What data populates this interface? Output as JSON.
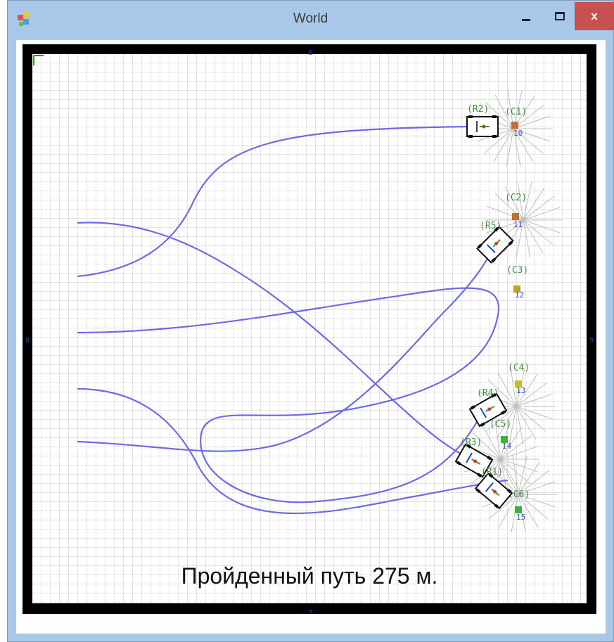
{
  "window": {
    "title": "World",
    "close_label": "x"
  },
  "arena": {
    "distance_text": "Пройденный путь 275 м.",
    "axis_top": "6",
    "axis_bottom": "7",
    "axis_left": "8",
    "axis_right": "9",
    "path_color": "#6b6bea",
    "wall_color": "#000000",
    "grid_color": "#c8c8c8",
    "label_color_green": "#3a9a3a",
    "label_color_blue": "#3050d0"
  },
  "robots": [
    {
      "label": "(R2)"
    },
    {
      "label": "(R5)"
    },
    {
      "label": "(R4)"
    },
    {
      "label": "(R3)"
    },
    {
      "label": "(R1)"
    }
  ],
  "targets": [
    {
      "label": "(C1)",
      "value": "10",
      "color": "#c07030"
    },
    {
      "label": "(C2)",
      "value": "11",
      "color": "#c07030"
    },
    {
      "label": "(C3)",
      "value": "12",
      "color": "#c0a030"
    },
    {
      "label": "(C4)",
      "value": "13",
      "color": "#c0c030"
    },
    {
      "label": "(C5)",
      "value": "14",
      "color": "#40b040"
    },
    {
      "label": "(C6)",
      "value": "15",
      "color": "#40b040"
    }
  ]
}
